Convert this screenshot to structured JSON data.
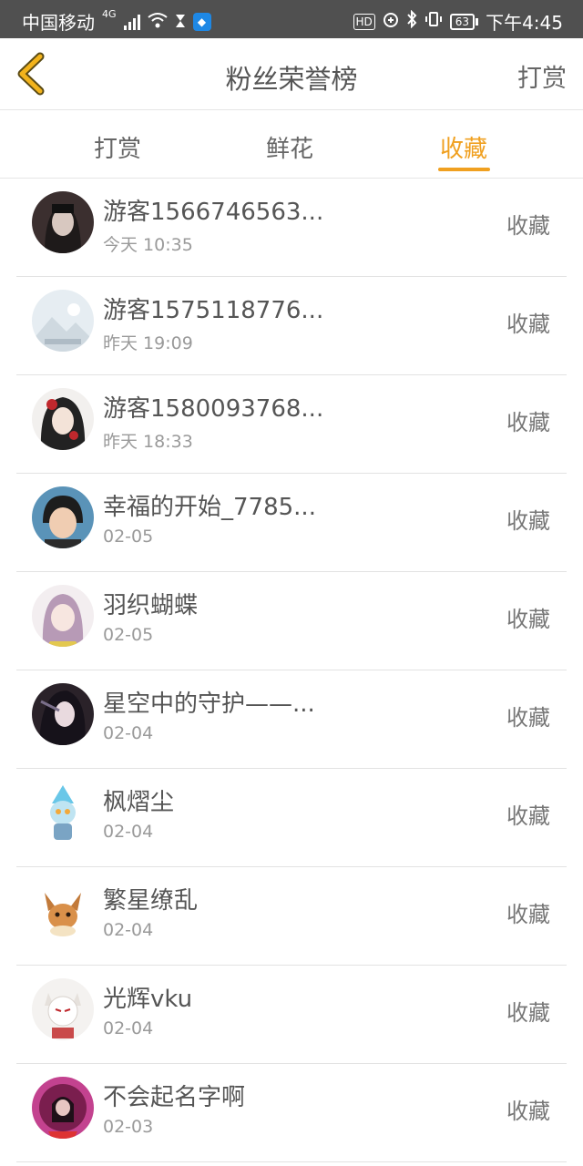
{
  "status_bar": {
    "carrier": "中国移动",
    "network": "4G",
    "battery": "63",
    "time": "下午4:45"
  },
  "header": {
    "title": "粉丝荣誉榜",
    "action": "打赏"
  },
  "tabs": [
    {
      "label": "打赏",
      "active": false
    },
    {
      "label": "鲜花",
      "active": false
    },
    {
      "label": "收藏",
      "active": true
    }
  ],
  "colors": {
    "accent": "#f0a020",
    "status_bar_bg": "#505050"
  },
  "list": [
    {
      "name": "游客1566746563...",
      "time": "今天 10:35",
      "action": "收藏",
      "avatar_icon": "avatar-dark-hair"
    },
    {
      "name": "游客1575118776...",
      "time": "昨天 19:09",
      "action": "收藏",
      "avatar_icon": "avatar-default-placeholder"
    },
    {
      "name": "游客1580093768...",
      "time": "昨天 18:33",
      "action": "收藏",
      "avatar_icon": "avatar-anime-girl-red"
    },
    {
      "name": "幸福的开始_7785...",
      "time": "02-05",
      "action": "收藏",
      "avatar_icon": "avatar-child-photo"
    },
    {
      "name": "羽织蝴蝶",
      "time": "02-05",
      "action": "收藏",
      "avatar_icon": "avatar-anime-purple"
    },
    {
      "name": "星空中的守护——...",
      "time": "02-04",
      "action": "收藏",
      "avatar_icon": "avatar-anime-dark"
    },
    {
      "name": "枫熠尘",
      "time": "02-04",
      "action": "收藏",
      "avatar_icon": "avatar-ultraman"
    },
    {
      "name": "繁星缭乱",
      "time": "02-04",
      "action": "收藏",
      "avatar_icon": "avatar-eevee"
    },
    {
      "name": "光辉vku",
      "time": "02-04",
      "action": "收藏",
      "avatar_icon": "avatar-fox-mask"
    },
    {
      "name": "不会起名字啊",
      "time": "02-03",
      "action": "收藏",
      "avatar_icon": "avatar-pink-circle"
    }
  ]
}
